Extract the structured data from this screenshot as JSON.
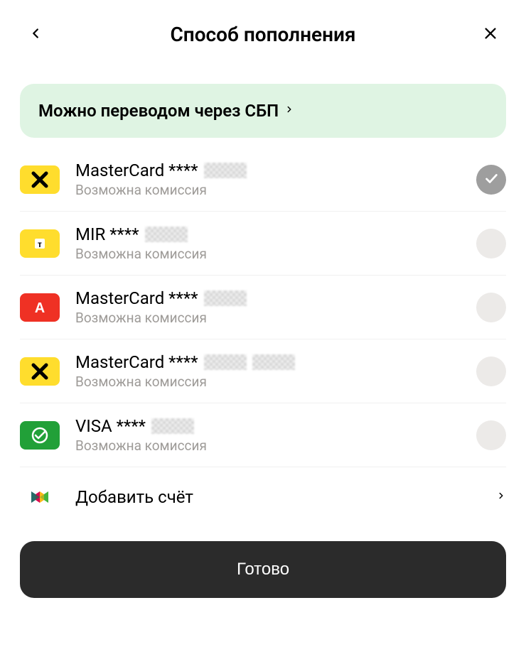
{
  "header": {
    "title": "Способ пополнения"
  },
  "banner": {
    "text": "Можно переводом через СБП"
  },
  "methods": [
    {
      "icon": "raiffeisen",
      "title_prefix": "MasterCard ****",
      "subtitle": "Возможна комиссия",
      "selected": true
    },
    {
      "icon": "tinkoff",
      "title_prefix": "MIR ****",
      "subtitle": "Возможна комиссия",
      "selected": false
    },
    {
      "icon": "alfa",
      "title_prefix": "MasterCard ****",
      "subtitle": "Возможна комиссия",
      "selected": false
    },
    {
      "icon": "raiffeisen",
      "title_prefix": "MasterCard ****",
      "subtitle": "Возможна комиссия",
      "selected": false
    },
    {
      "icon": "sber",
      "title_prefix": "VISA ****",
      "subtitle": "Возможна комиссия",
      "selected": false
    }
  ],
  "add_account": {
    "label": "Добавить счёт"
  },
  "done_button": {
    "label": "Готово"
  }
}
